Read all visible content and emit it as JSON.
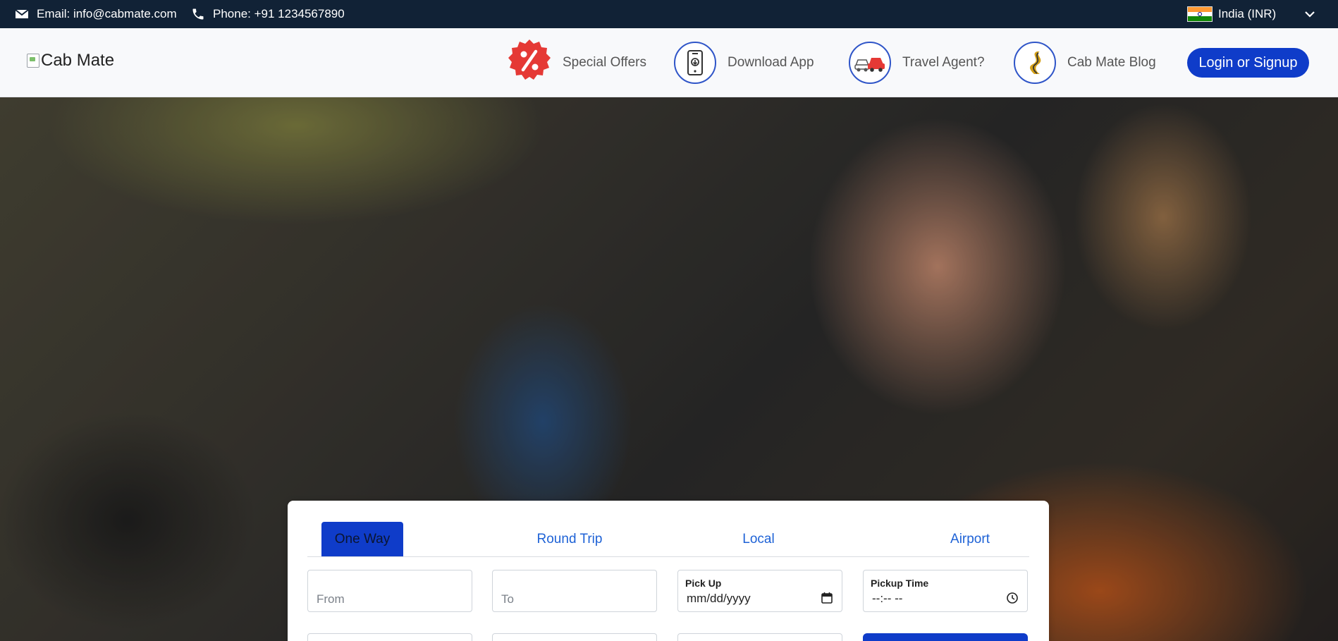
{
  "topbar": {
    "email": "Email: info@cabmate.com",
    "phone": "Phone: +91 1234567890",
    "country": "India (INR)",
    "icons": {
      "email": "mail-icon",
      "phone": "phone-icon",
      "flag": "india-flag-icon",
      "dropdown": "chevron-down-icon"
    }
  },
  "header": {
    "logo_alt": "Cab Mate",
    "nav": [
      {
        "label": "Special Offers",
        "icon": "discount-badge-icon"
      },
      {
        "label": "Download App",
        "icon": "mobile-app-icon"
      },
      {
        "label": "Travel Agent?",
        "icon": "cars-icon"
      },
      {
        "label": "Cab Mate Blog",
        "icon": "road-icon"
      }
    ],
    "login_label": "Login or Signup"
  },
  "booking": {
    "tabs": [
      {
        "label": "One Way",
        "active": true
      },
      {
        "label": "Round Trip",
        "active": false
      },
      {
        "label": "Local",
        "active": false
      },
      {
        "label": "Airport",
        "active": false
      }
    ],
    "from_placeholder": "From",
    "to_placeholder": "To",
    "pickup_label": "Pick Up",
    "pickup_value": "mm/dd/yyyy",
    "pickup_time_label": "Pickup Time",
    "pickup_time_value": "--:-- --"
  },
  "colors": {
    "topbar_bg": "#112236",
    "accent": "#0f3cc9",
    "tab_text": "#1e62d6",
    "offer_red": "#e53935"
  }
}
